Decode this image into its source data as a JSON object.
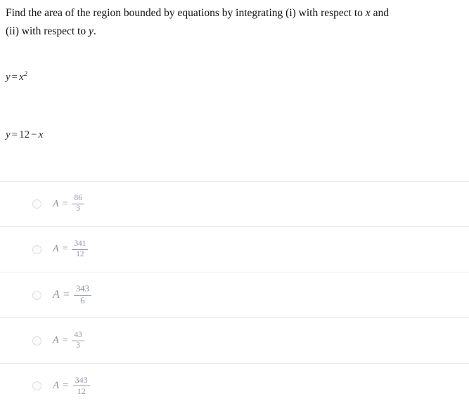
{
  "question": {
    "line1_before_x": "Find the area of the region bounded by equations by integrating (i) with respect to ",
    "var_x": "x",
    "line1_after_x": " and",
    "line2_before_y": "(ii) with respect to ",
    "var_y": "y",
    "line2_after_y": "."
  },
  "equations": [
    {
      "id": "equation-1",
      "lhs": "y",
      "operator": "=",
      "base": "x",
      "exponent": "2",
      "text": "y = x^2"
    },
    {
      "id": "equation-2",
      "lhs": "y",
      "operator": "=",
      "rhs_number": "12",
      "rhs_operator": "−",
      "rhs_var": "x",
      "text": "y = 12 − x"
    }
  ],
  "options": [
    {
      "id": "option-a",
      "variable": "A",
      "equals": "=",
      "numerator": "86",
      "denominator": "3",
      "text": "A = 86/3",
      "selected": false
    },
    {
      "id": "option-b",
      "variable": "A",
      "equals": "=",
      "numerator": "341",
      "denominator": "12",
      "text": "A = 341/12",
      "selected": false
    },
    {
      "id": "option-c",
      "variable": "A",
      "equals": "=",
      "numerator": "343",
      "denominator": "6",
      "text": "A = 343/6",
      "selected": false
    },
    {
      "id": "option-d",
      "variable": "A",
      "equals": "=",
      "numerator": "43",
      "denominator": "3",
      "text": "A = 43/3",
      "selected": false
    },
    {
      "id": "option-e",
      "variable": "A",
      "equals": "=",
      "numerator": "343",
      "denominator": "12",
      "text": "A = 343/12",
      "selected": false
    }
  ],
  "colors": {
    "question_text": "#0f0f14",
    "equation_text": "#2b2b35",
    "option_text_muted": "#9195a8",
    "option_text_dark": "#3c3f4d",
    "divider": "#e9e9ec",
    "radio_border": "#dcdcdf",
    "background": "#ffffff"
  }
}
